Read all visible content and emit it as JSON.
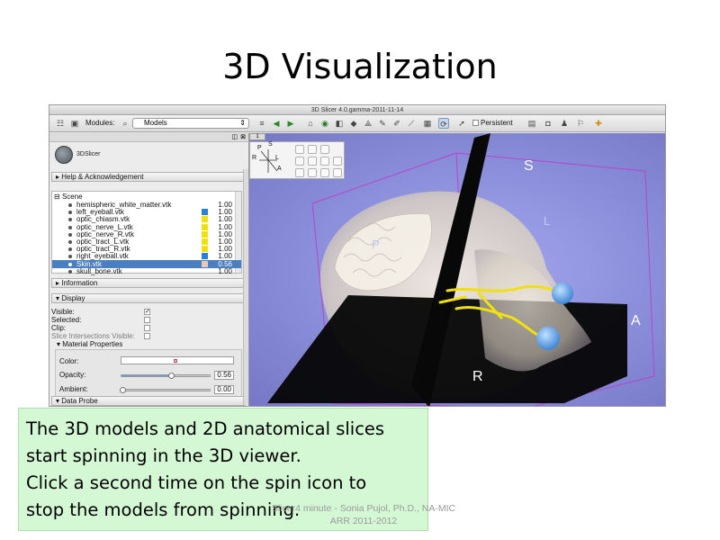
{
  "slide": {
    "title": "3D Visualization",
    "callout_lines": [
      "The 3D models and 2D anatomical slices",
      "start spinning in the 3D viewer.",
      "Click a second time on the spin icon to",
      "stop the models from spinning."
    ],
    "footer_lines": [
      "Slicer4 minute - Sonia Pujol, Ph.D., NA-MIC",
      "ARR 2011-2012"
    ]
  },
  "window": {
    "title": "3D Slicer 4.0.gamma-2011-11-14"
  },
  "toolbar": {
    "modules_label": "Modules:",
    "module_selected": "Models",
    "persistent_label": "Persistent"
  },
  "panel": {
    "logo_text": "3DSlicer",
    "help_section": "Help & Acknowledgement",
    "scene_label": "Scene",
    "tree": [
      {
        "name": "hemispheric_white_matter.vtk",
        "opacity": "1.00",
        "color": ""
      },
      {
        "name": "left_eyeball.vtk",
        "opacity": "1.00",
        "color": "#2a7fd6"
      },
      {
        "name": "optic_chiasm.vtk",
        "opacity": "1.00",
        "color": "#f0e010"
      },
      {
        "name": "optic_nerve_L.vtk",
        "opacity": "1.00",
        "color": "#f0e010"
      },
      {
        "name": "optic_nerve_R.vtk",
        "opacity": "1.00",
        "color": "#f0e010"
      },
      {
        "name": "optic_tract_L.vtk",
        "opacity": "1.00",
        "color": "#f0e010"
      },
      {
        "name": "optic_tract_R.vtk",
        "opacity": "1.00",
        "color": "#f0e010"
      },
      {
        "name": "right_eyeball.vtk",
        "opacity": "1.00",
        "color": "#2a7fd6"
      },
      {
        "name": "Skin.vtk",
        "opacity": "0.56",
        "color": "#e9c8b8"
      },
      {
        "name": "skull_bone.vtk",
        "opacity": "1.00",
        "color": ""
      }
    ],
    "information_section": "Information",
    "display_section": "Display",
    "display": {
      "visible": "Visible:",
      "selected": "Selected:",
      "clip": "Clip:",
      "slice_intersections": "Slice Intersections Visible:",
      "material": "Material Properties",
      "color": "Color:",
      "opacity": "Opacity:",
      "opacity_value": "0.56",
      "ambient": "Ambient:",
      "ambient_value": "0.00"
    },
    "data_probe_section": "Data Probe"
  },
  "view": {
    "tab_label": "1",
    "orientation": {
      "p": "P",
      "s": "S",
      "r": "R",
      "l": "L",
      "a": "A"
    },
    "labels": {
      "s": "S",
      "r": "R",
      "a": "A",
      "l": "L",
      "p": "P"
    }
  },
  "colors": {
    "view_bg": "#8a8dd9",
    "nerve": "#f0e010",
    "eyeball": "#2a7fd6",
    "callout_bg": "#d4f7d4",
    "selection": "#4a7fc0"
  }
}
